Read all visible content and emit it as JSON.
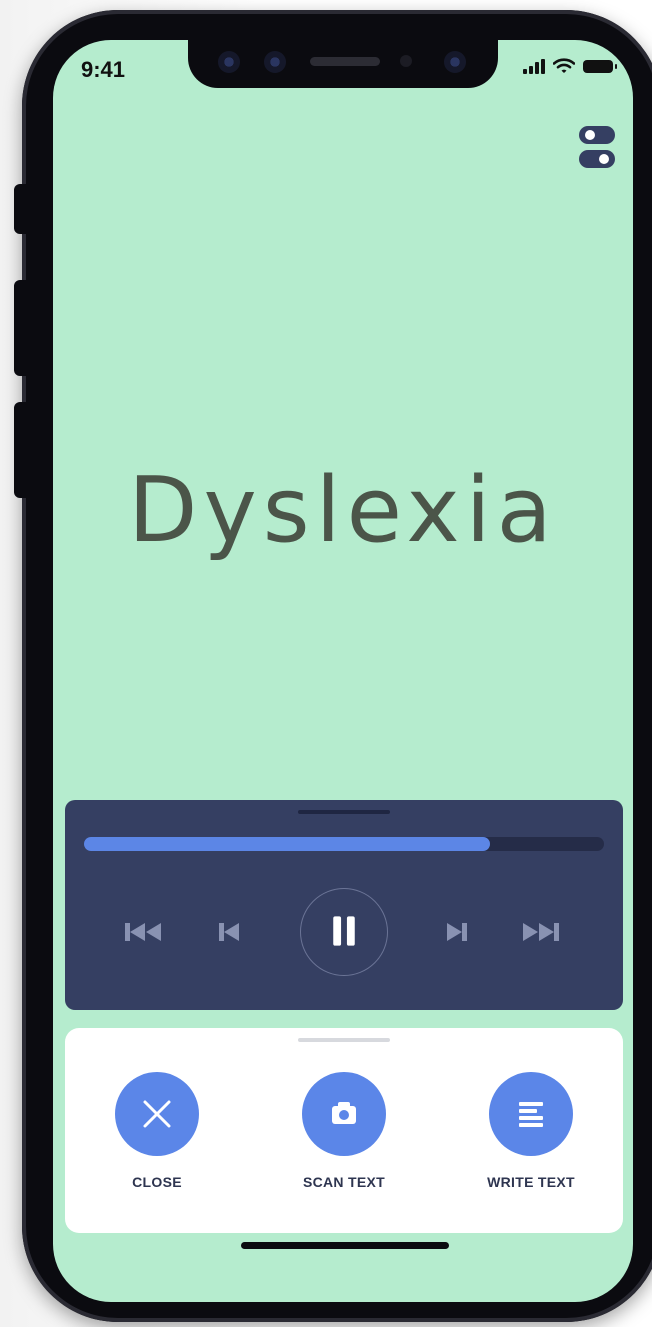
{
  "status_bar": {
    "time": "9:41"
  },
  "main": {
    "word": "Dyslexia"
  },
  "player": {
    "progress": 0.78,
    "controls": [
      "skip-to-start",
      "previous",
      "pause",
      "next",
      "skip-to-end"
    ]
  },
  "actions": [
    {
      "label": "CLOSE",
      "icon": "close-icon"
    },
    {
      "label": "SCAN TEXT",
      "icon": "camera-icon"
    },
    {
      "label": "WRITE TEXT",
      "icon": "text-lines-icon"
    }
  ],
  "colors": {
    "background": "#b5ecce",
    "player_panel": "#353f62",
    "progress_fill": "#5c86e6",
    "action_button": "#5b86e8",
    "word_text": "#4b5549"
  }
}
